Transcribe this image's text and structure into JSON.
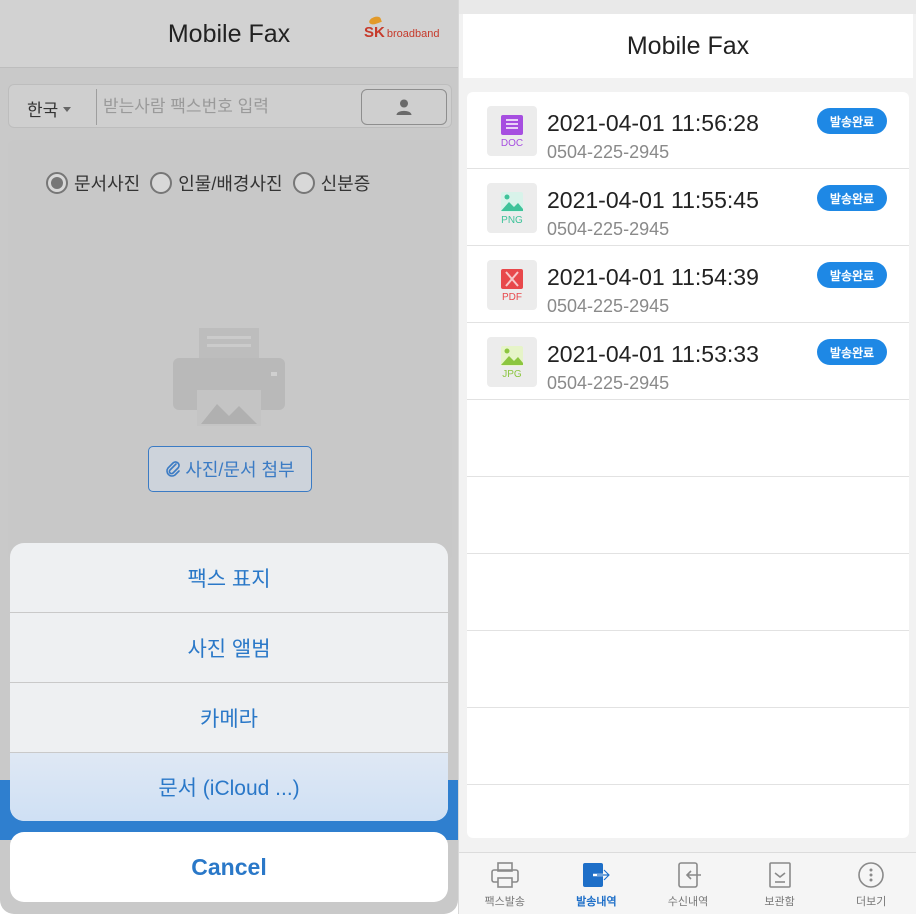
{
  "left": {
    "app_title": "Mobile Fax",
    "brand": {
      "mark": "SK",
      "sub": "broadband",
      "color": "#c63a2b"
    },
    "country": "한국",
    "fax_placeholder": "받는사람 팩스번호 입력",
    "contact_icon": "person-icon",
    "radio_options": [
      {
        "label": "문서사진",
        "selected": true
      },
      {
        "label": "인물/배경사진",
        "selected": false
      },
      {
        "label": "신분증",
        "selected": false
      }
    ],
    "attach_label": "사진/문서 첨부",
    "action_sheet": {
      "items": [
        "팩스 표지",
        "사진 앨범",
        "카메라",
        "문서 (iCloud ...)"
      ],
      "cancel": "Cancel"
    },
    "accent_color": "#2a78c8"
  },
  "right": {
    "app_title": "Mobile Fax",
    "items": [
      {
        "type": "DOC",
        "datetime": "2021-04-01 11:56:28",
        "number": "0504-225-2945",
        "status": "발송완료"
      },
      {
        "type": "PNG",
        "datetime": "2021-04-01 11:55:45",
        "number": "0504-225-2945",
        "status": "발송완료"
      },
      {
        "type": "PDF",
        "datetime": "2021-04-01 11:54:39",
        "number": "0504-225-2945",
        "status": "발송완료"
      },
      {
        "type": "JPG",
        "datetime": "2021-04-01 11:53:33",
        "number": "0504-225-2945",
        "status": "발송완료"
      }
    ],
    "tabs": [
      {
        "label": "팩스발송",
        "icon": "printer-icon",
        "active": false
      },
      {
        "label": "발송내역",
        "icon": "send-history-icon",
        "active": true
      },
      {
        "label": "수신내역",
        "icon": "receive-history-icon",
        "active": false
      },
      {
        "label": "보관함",
        "icon": "archive-icon",
        "active": false
      },
      {
        "label": "더보기",
        "icon": "more-icon",
        "active": false
      }
    ],
    "badge_color": "#1e88e5"
  }
}
